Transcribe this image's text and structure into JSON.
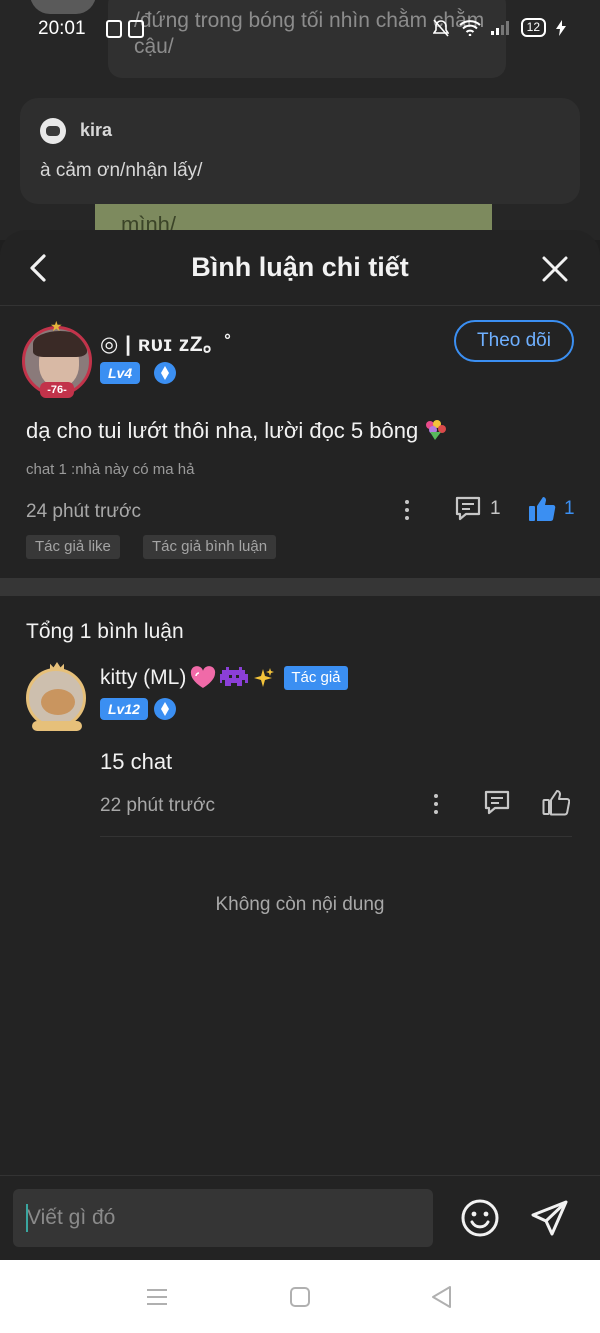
{
  "status_bar": {
    "time": "20:01",
    "battery": "12"
  },
  "background": {
    "bubble_text": "/đứng trong bóng tối nhìn chằm chằm cậu/",
    "comment_name": "kira",
    "comment_text": "à cảm ơn/nhận lấy/",
    "green_text": "mình/"
  },
  "header": {
    "title": "Bình luận chi tiết"
  },
  "main_comment": {
    "name": "◎ | ʀᴜɪ zZ。˚",
    "avatar_badge": "-76-",
    "level": "Lv4",
    "follow_label": "Theo dõi",
    "text": "dạ cho tui lướt thôi nha, lười đọc 5 bông",
    "sub_text": "chat 1 :nhà này có ma hả",
    "time": "24 phút trước",
    "reply_count": "1",
    "like_count": "1",
    "tags": [
      "Tác giả like",
      "Tác giả bình luận"
    ]
  },
  "total_label": "Tổng 1 bình luận",
  "reply": {
    "name": "kitty (ML)",
    "author_tag": "Tác giả",
    "level": "Lv12",
    "text": "15 chat",
    "time": "22 phút trước"
  },
  "no_more_label": "Không còn nội dung",
  "input": {
    "placeholder": "Viết gì đó"
  },
  "colors": {
    "accent": "#3b8ff2",
    "background": "#232323",
    "like_active": "#3b8ff2"
  }
}
